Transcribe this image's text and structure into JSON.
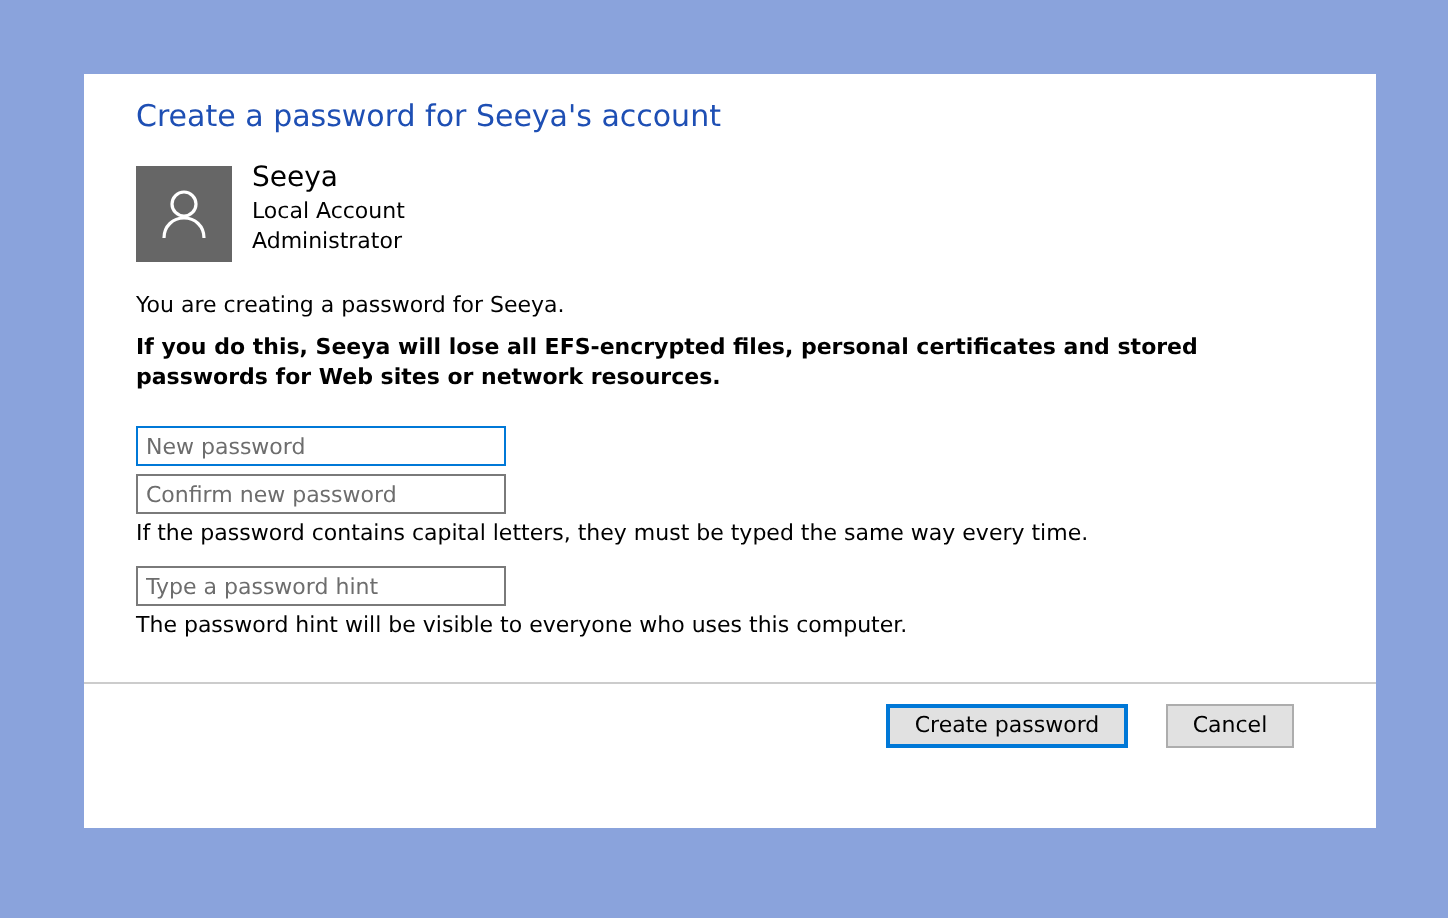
{
  "dialog": {
    "title": "Create a password for Seeya's account",
    "user": {
      "name": "Seeya",
      "account_type": "Local Account",
      "role": "Administrator"
    },
    "intro": "You are creating a password for Seeya.",
    "warning": "If you do this, Seeya will lose all EFS-encrypted files, personal certificates and stored passwords for Web sites or network resources.",
    "fields": [
      {
        "placeholder": "New password",
        "focused": true
      },
      {
        "placeholder": "Confirm new password",
        "focused": false,
        "note": "If the password contains capital letters, they must be typed the same way every time."
      },
      {
        "placeholder": "Type a password hint",
        "focused": false,
        "note": "The password hint will be visible to everyone who uses this computer."
      }
    ],
    "buttons": [
      {
        "label": "Create password",
        "default": true
      },
      {
        "label": "Cancel",
        "default": false
      }
    ]
  }
}
